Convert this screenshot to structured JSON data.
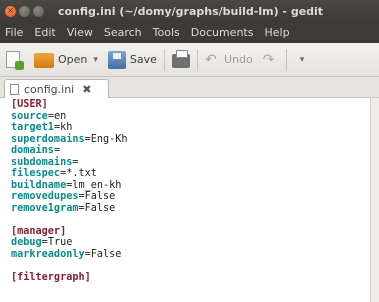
{
  "window": {
    "title": "config.ini (~/domy/graphs/build-lm) - gedit",
    "close_glyph": "×",
    "min_glyph": "",
    "max_glyph": ""
  },
  "menu": {
    "items": [
      "File",
      "Edit",
      "View",
      "Search",
      "Tools",
      "Documents",
      "Help"
    ]
  },
  "toolbar": {
    "open_label": "Open",
    "open_caret": "▾",
    "save_label": "Save",
    "undo_label": "Undo",
    "more_caret": "▾"
  },
  "tab": {
    "label": "config.ini",
    "close_glyph": "✖"
  },
  "editor": {
    "lines": [
      {
        "type": "section",
        "text": "[USER]"
      },
      {
        "type": "kv",
        "key": "source",
        "value": "en"
      },
      {
        "type": "kv",
        "key": "target1",
        "value": "kh"
      },
      {
        "type": "kv",
        "key": "superdomains",
        "value": "Eng-Kh"
      },
      {
        "type": "kv",
        "key": "domains",
        "value": ""
      },
      {
        "type": "kv",
        "key": "subdomains",
        "value": ""
      },
      {
        "type": "kv",
        "key": "filespec",
        "value": "*.txt"
      },
      {
        "type": "kv",
        "key": "buildname",
        "value": "lm_en-kh"
      },
      {
        "type": "kv",
        "key": "removedupes",
        "value": "False"
      },
      {
        "type": "kv",
        "key": "remove1gram",
        "value": "False"
      },
      {
        "type": "blank"
      },
      {
        "type": "section",
        "text": "[manager]"
      },
      {
        "type": "kv",
        "key": "debug",
        "value": "True"
      },
      {
        "type": "kv",
        "key": "markreadonly",
        "value": "False"
      },
      {
        "type": "blank"
      },
      {
        "type": "section",
        "text": "[filtergraph]"
      }
    ]
  },
  "colors": {
    "section": "#7d2330",
    "key": "#0b8a8a",
    "close_button": "#d9531e"
  }
}
